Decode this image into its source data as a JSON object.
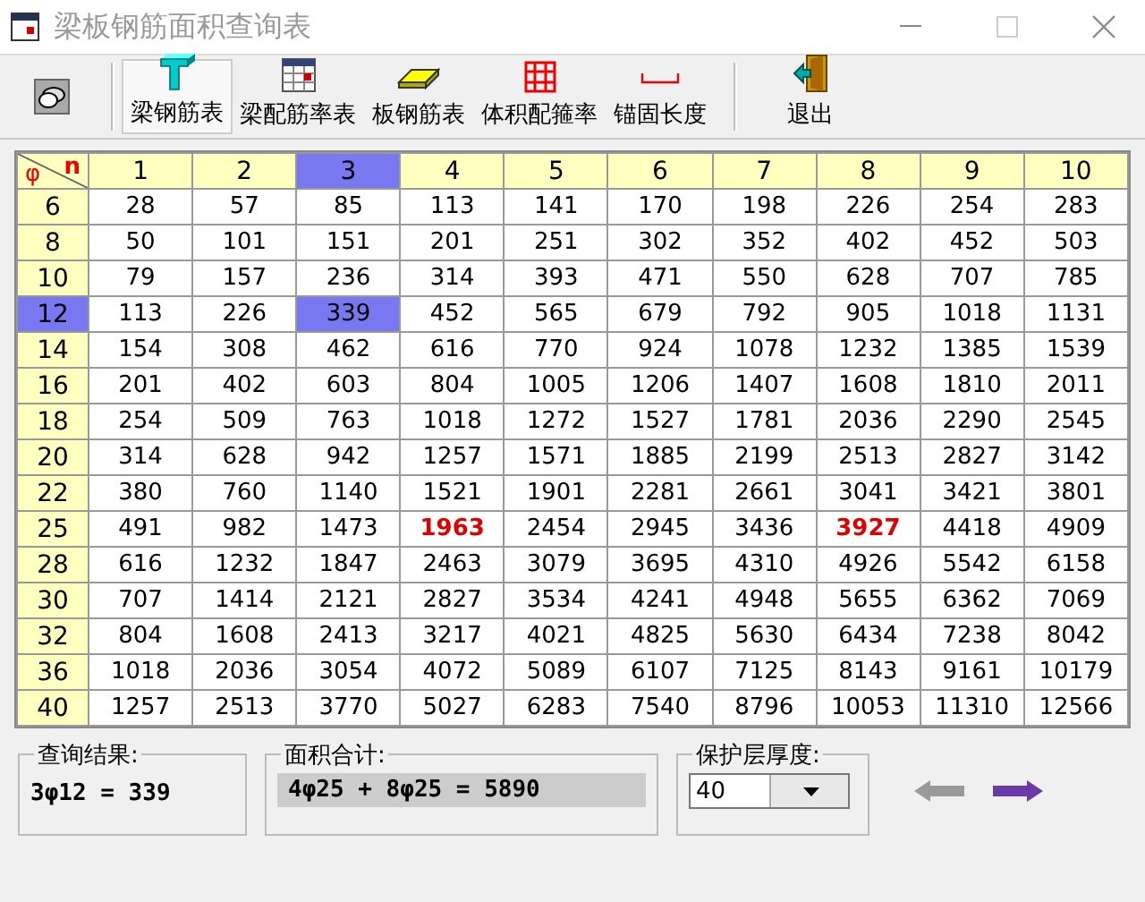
{
  "window": {
    "title": "梁板钢筋面积查询表"
  },
  "toolbar": {
    "buttons": [
      {
        "kind": "beam",
        "label": "梁钢筋表",
        "selected": true
      },
      {
        "kind": "ratio",
        "label": "梁配筋率表",
        "selected": false
      },
      {
        "kind": "slab",
        "label": "板钢筋表",
        "selected": false
      },
      {
        "kind": "grid",
        "label": "体积配箍率",
        "selected": false
      },
      {
        "kind": "anchor",
        "label": "锚固长度",
        "selected": false
      },
      {
        "kind": "exit",
        "label": "退出",
        "selected": false
      }
    ]
  },
  "table": {
    "corner": {
      "phi": "φ",
      "n": "n"
    },
    "columns": [
      {
        "label": "1",
        "selected": false
      },
      {
        "label": "2",
        "selected": false
      },
      {
        "label": "3",
        "selected": true
      },
      {
        "label": "4",
        "selected": false
      },
      {
        "label": "5",
        "selected": false
      },
      {
        "label": "6",
        "selected": false
      },
      {
        "label": "7",
        "selected": false
      },
      {
        "label": "8",
        "selected": false
      },
      {
        "label": "9",
        "selected": false
      },
      {
        "label": "10",
        "selected": false
      }
    ],
    "rows": [
      {
        "label": "6",
        "selected": false,
        "highlighted": [],
        "cells": [
          "28",
          "57",
          "85",
          "113",
          "141",
          "170",
          "198",
          "226",
          "254",
          "283"
        ]
      },
      {
        "label": "8",
        "selected": false,
        "highlighted": [],
        "cells": [
          "50",
          "101",
          "151",
          "201",
          "251",
          "302",
          "352",
          "402",
          "452",
          "503"
        ]
      },
      {
        "label": "10",
        "selected": false,
        "highlighted": [],
        "cells": [
          "79",
          "157",
          "236",
          "314",
          "393",
          "471",
          "550",
          "628",
          "707",
          "785"
        ]
      },
      {
        "label": "12",
        "selected": true,
        "highlighted": [],
        "cells": [
          "113",
          "226",
          "339",
          "452",
          "565",
          "679",
          "792",
          "905",
          "1018",
          "1131"
        ]
      },
      {
        "label": "14",
        "selected": false,
        "highlighted": [],
        "cells": [
          "154",
          "308",
          "462",
          "616",
          "770",
          "924",
          "1078",
          "1232",
          "1385",
          "1539"
        ]
      },
      {
        "label": "16",
        "selected": false,
        "highlighted": [],
        "cells": [
          "201",
          "402",
          "603",
          "804",
          "1005",
          "1206",
          "1407",
          "1608",
          "1810",
          "2011"
        ]
      },
      {
        "label": "18",
        "selected": false,
        "highlighted": [],
        "cells": [
          "254",
          "509",
          "763",
          "1018",
          "1272",
          "1527",
          "1781",
          "2036",
          "2290",
          "2545"
        ]
      },
      {
        "label": "20",
        "selected": false,
        "highlighted": [],
        "cells": [
          "314",
          "628",
          "942",
          "1257",
          "1571",
          "1885",
          "2199",
          "2513",
          "2827",
          "3142"
        ]
      },
      {
        "label": "22",
        "selected": false,
        "highlighted": [],
        "cells": [
          "380",
          "760",
          "1140",
          "1521",
          "1901",
          "2281",
          "2661",
          "3041",
          "3421",
          "3801"
        ]
      },
      {
        "label": "25",
        "selected": false,
        "highlighted": [
          false,
          false,
          false,
          true,
          false,
          false,
          false,
          true,
          false,
          false
        ],
        "cells": [
          "491",
          "982",
          "1473",
          "1963",
          "2454",
          "2945",
          "3436",
          "3927",
          "4418",
          "4909"
        ]
      },
      {
        "label": "28",
        "selected": false,
        "highlighted": [],
        "cells": [
          "616",
          "1232",
          "1847",
          "2463",
          "3079",
          "3695",
          "4310",
          "4926",
          "5542",
          "6158"
        ]
      },
      {
        "label": "30",
        "selected": false,
        "highlighted": [],
        "cells": [
          "707",
          "1414",
          "2121",
          "2827",
          "3534",
          "4241",
          "4948",
          "5655",
          "6362",
          "7069"
        ]
      },
      {
        "label": "32",
        "selected": false,
        "highlighted": [],
        "cells": [
          "804",
          "1608",
          "2413",
          "3217",
          "4021",
          "4825",
          "5630",
          "6434",
          "7238",
          "8042"
        ]
      },
      {
        "label": "36",
        "selected": false,
        "highlighted": [],
        "cells": [
          "1018",
          "2036",
          "3054",
          "4072",
          "5089",
          "6107",
          "7125",
          "8143",
          "9161",
          "10179"
        ]
      },
      {
        "label": "40",
        "selected": false,
        "highlighted": [],
        "cells": [
          "1257",
          "2513",
          "3770",
          "5027",
          "6283",
          "7540",
          "8796",
          "10053",
          "11310",
          "12566"
        ]
      }
    ]
  },
  "query_result": {
    "label": "查询结果:",
    "value": "3φ12 = 339"
  },
  "area_total": {
    "label": "面积合计:",
    "value": "4φ25 + 8φ25 = 5890"
  },
  "cover": {
    "label": "保护层厚度:",
    "value": "40"
  },
  "nav": [
    {
      "kind": "back",
      "disabled": true
    },
    {
      "kind": "forward",
      "disabled": false
    }
  ]
}
